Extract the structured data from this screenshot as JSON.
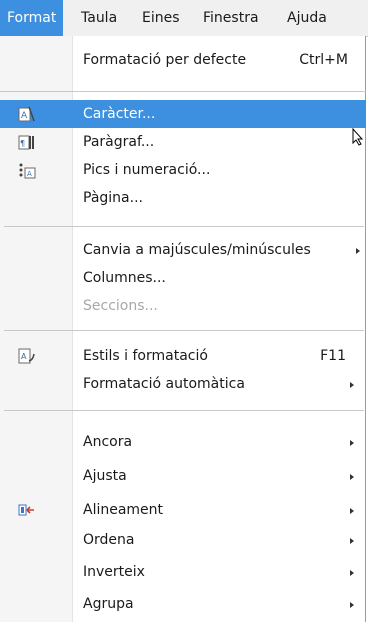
{
  "menubar": {
    "items": [
      {
        "label": "Format",
        "active": true
      },
      {
        "label": "Taula"
      },
      {
        "label": "Eines"
      },
      {
        "label": "Finestra"
      },
      {
        "label": "Ajuda"
      }
    ]
  },
  "menu": {
    "items": [
      {
        "label": "Formatació per defecte",
        "shortcut": "Ctrl+M"
      },
      {
        "label": "Caràcter...",
        "highlighted": true,
        "icon": "character-icon"
      },
      {
        "label": "Paràgraf...",
        "icon": "paragraph-icon"
      },
      {
        "label": "Pics i numeració...",
        "icon": "bullets-numbering-icon"
      },
      {
        "label": "Pàgina..."
      },
      {
        "label": "Canvia a majúscules/minúscules",
        "submenu": true
      },
      {
        "label": "Columnes..."
      },
      {
        "label": "Seccions...",
        "disabled": true
      },
      {
        "label": "Estils i formatació",
        "shortcut": "F11",
        "icon": "styles-icon"
      },
      {
        "label": "Formatació automàtica",
        "submenu": true
      },
      {
        "label": "Ancora",
        "submenu": true
      },
      {
        "label": "Ajusta",
        "submenu": true
      },
      {
        "label": "Alineament",
        "submenu": true,
        "icon": "alignment-icon"
      },
      {
        "label": "Ordena",
        "submenu": true
      },
      {
        "label": "Inverteix",
        "submenu": true
      },
      {
        "label": "Agrupa",
        "submenu": true
      }
    ]
  },
  "colors": {
    "highlight": "#3d8fdf",
    "menubar_bg": "#f0f0f0",
    "disabled_text": "#a8a8a8"
  }
}
